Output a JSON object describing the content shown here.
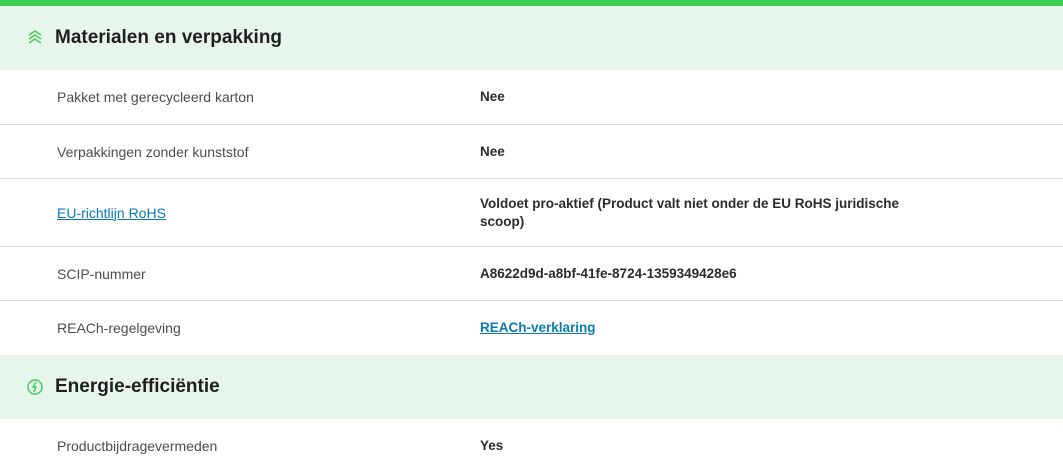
{
  "sections": [
    {
      "title": "Materialen en verpakking",
      "icon": "recycle-leaf-icon",
      "rows": [
        {
          "label": "Pakket met gerecycleerd karton",
          "value": "Nee"
        },
        {
          "label": "Verpakkingen zonder kunststof",
          "value": "Nee"
        },
        {
          "label": "EU-richtlijn RoHS",
          "value": "Voldoet pro-aktief (Product valt niet onder de EU RoHS juridische scoop)"
        },
        {
          "label": "SCIP-nummer",
          "value": "A8622d9d-a8bf-41fe-8724-1359349428e6"
        },
        {
          "label": "REACh-regelgeving",
          "value": "REACh-verklaring"
        }
      ]
    },
    {
      "title": "Energie-efficiëntie",
      "icon": "energy-leaf-icon",
      "rows": [
        {
          "label": "Productbijdragevermeden",
          "value": "Yes"
        }
      ]
    }
  ],
  "colors": {
    "accent_bar": "#3dcd58",
    "header_bg": "#e7f6ea",
    "link": "#0a7bb5"
  }
}
